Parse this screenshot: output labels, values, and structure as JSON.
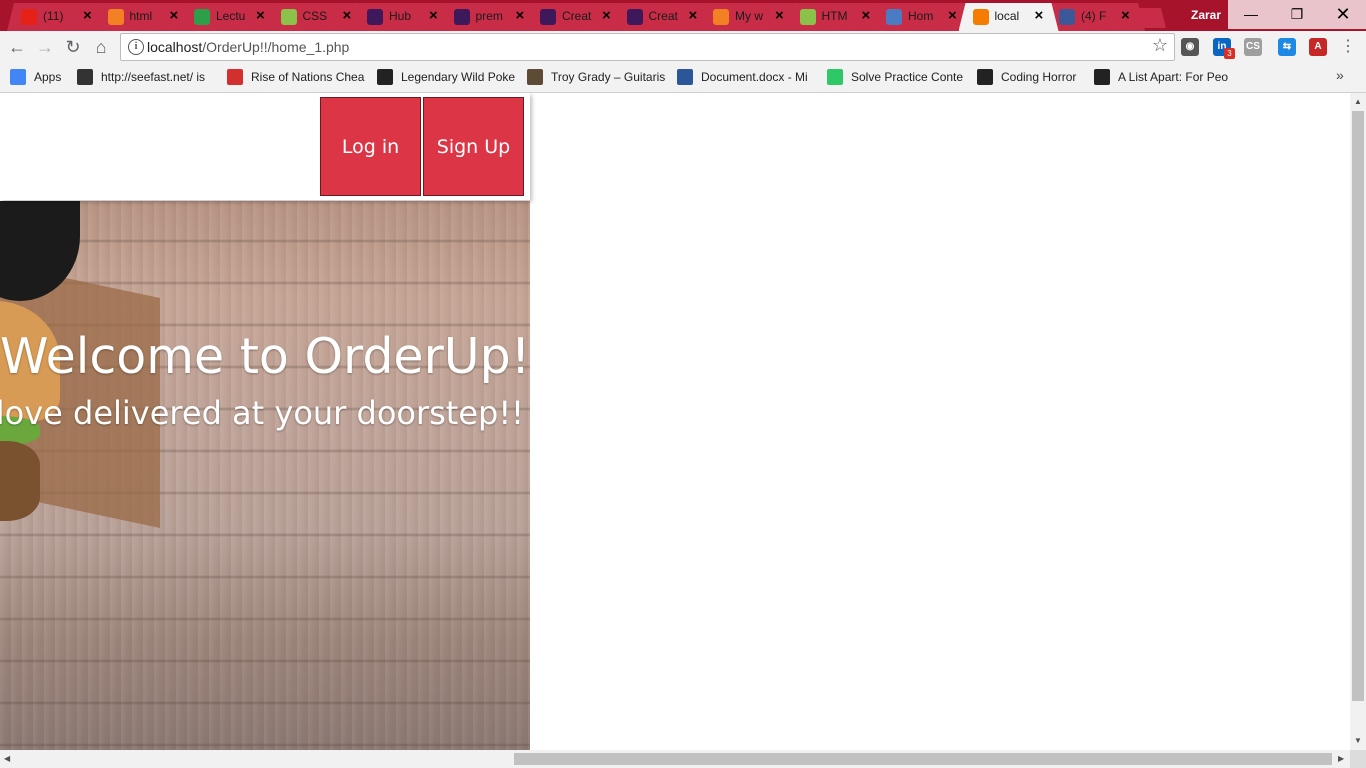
{
  "browser": {
    "tabs": [
      {
        "label": "(11)",
        "favicon": "youtube-icon",
        "color": "#e62117",
        "active": false
      },
      {
        "label": "html",
        "favicon": "stackoverflow-icon",
        "color": "#f48024",
        "active": false
      },
      {
        "label": "Lectu",
        "favicon": "drive-icon",
        "color": "#2d9f4a",
        "active": false
      },
      {
        "label": "CSS",
        "favicon": "w3schools-icon",
        "color": "#8bc34a",
        "active": false
      },
      {
        "label": "Hub",
        "favicon": "premier-league-icon",
        "color": "#3d195b",
        "active": false
      },
      {
        "label": "prem",
        "favicon": "premier-league-icon",
        "color": "#3d195b",
        "active": false
      },
      {
        "label": "Creat",
        "favicon": "premier-league-icon",
        "color": "#3d195b",
        "active": false
      },
      {
        "label": "Creat",
        "favicon": "premier-league-icon",
        "color": "#3d195b",
        "active": false
      },
      {
        "label": "My w",
        "favicon": "stackoverflow-icon",
        "color": "#f48024",
        "active": false
      },
      {
        "label": "HTM",
        "favicon": "w3schools-icon",
        "color": "#8bc34a",
        "active": false
      },
      {
        "label": "Hom",
        "favicon": "tab-icon",
        "color": "#4a7cc4",
        "active": false
      },
      {
        "label": "local",
        "favicon": "xampp-icon",
        "color": "#f57c00",
        "active": true
      },
      {
        "label": "(4) F",
        "favicon": "facebook-icon",
        "color": "#3b5998",
        "active": false
      }
    ],
    "user_name": "Zarar",
    "window_controls": {
      "minimize": "—",
      "maximize": "❐",
      "close": "✕"
    },
    "url": {
      "host": "localhost",
      "path": "/OrderUp!!/home_1.php"
    },
    "extensions": [
      {
        "name": "ghostery-icon",
        "color": "#555555",
        "text": "◉"
      },
      {
        "name": "linkedin-icon",
        "color": "#0a66c2",
        "text": "in"
      },
      {
        "name": "css-viewer-icon",
        "color": "#9e9e9e",
        "text": "CS"
      },
      {
        "name": "cast-icon",
        "color": "#1e88e5",
        "text": "⇆"
      },
      {
        "name": "pdf-icon",
        "color": "#c62828",
        "text": "A"
      }
    ],
    "linkedin_badge": "3",
    "bookmarks": [
      {
        "label": "Apps",
        "icon": "apps-grid-icon",
        "color": "#4285f4"
      },
      {
        "label": "http://seefast.net/ is",
        "icon": "seefast-icon",
        "color": "#333333"
      },
      {
        "label": "Rise of Nations Chea",
        "icon": "rise-of-nations-icon",
        "color": "#d32f2f"
      },
      {
        "label": "Legendary Wild Poke",
        "icon": "pokemon-icon",
        "color": "#222222"
      },
      {
        "label": "Troy Grady – Guitaris",
        "icon": "troy-grady-icon",
        "color": "#5d4b35"
      },
      {
        "label": "Document.docx - Mi",
        "icon": "word-icon",
        "color": "#2b579a"
      },
      {
        "label": "Solve Practice Conte",
        "icon": "hackerrank-icon",
        "color": "#2ec866"
      },
      {
        "label": "Coding Horror",
        "icon": "coding-horror-icon",
        "color": "#222222"
      },
      {
        "label": "A List Apart: For Peo",
        "icon": "alistapart-icon",
        "color": "#222222"
      }
    ]
  },
  "page": {
    "nav": {
      "login": "Log in",
      "signup": "Sign Up"
    },
    "hero": {
      "title": "Welcome to OrderUp!!",
      "subtitle": "ou love delivered at your doorstep!!"
    },
    "accent_color": "#dc3545"
  }
}
